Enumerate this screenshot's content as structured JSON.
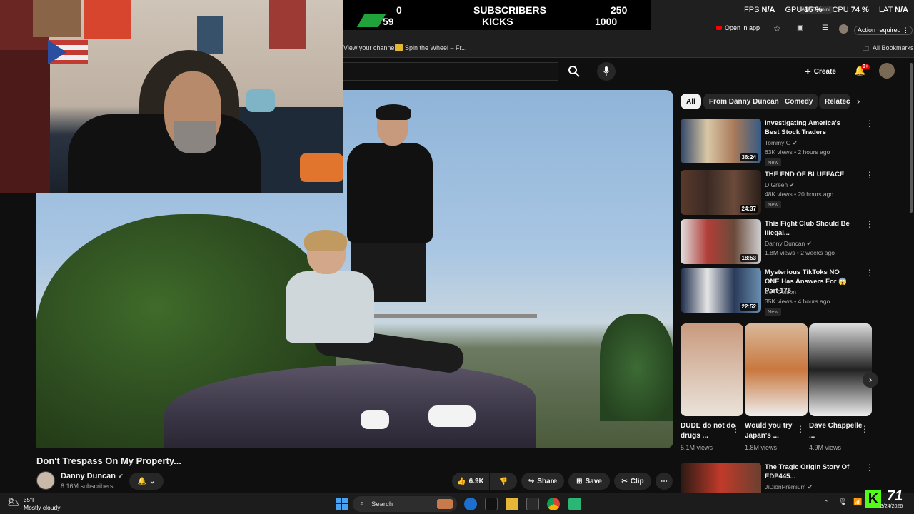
{
  "overlay": {
    "subscribers_left": "0",
    "subscribers_label": "SUBSCRIBERS",
    "subscribers_right": "250",
    "kicks_left": "59",
    "kicks_label": "KICKS",
    "kicks_right": "1000"
  },
  "stats": {
    "fps_label": "FPS",
    "fps_value": "N/A",
    "gpu_label": "GPU",
    "gpu_value": "15 %",
    "cpu_label": "CPU",
    "cpu_value": "74 %",
    "lat_label": "LAT",
    "lat_value": "N/A",
    "ask_gemini": "Ask Gemini"
  },
  "browser": {
    "open_in_app": "Open in app",
    "action_required": "Action required",
    "bookmark1": "View your channel",
    "bookmark2": "Spin the Wheel – Fr...",
    "all_bookmarks": "All Bookmarks"
  },
  "youtube": {
    "create_label": "Create",
    "notification_badge": "9+"
  },
  "video": {
    "title": "Don't Trespass On My Property...",
    "channel_name": "Danny Duncan",
    "subscribers": "8.16M subscribers",
    "likes": "6.9K",
    "share_label": "Share",
    "save_label": "Save",
    "clip_label": "Clip"
  },
  "chips": [
    "All",
    "From Danny Duncan",
    "Comedy",
    "Relatec"
  ],
  "recommendations": [
    {
      "title": "Investigating America's Best Stock Traders",
      "channel": "Tommy G",
      "meta": "63K views • 2 hours ago",
      "duration": "36:24",
      "new": "New"
    },
    {
      "title": "THE END OF BLUEFACE",
      "channel": "D Green",
      "meta": "48K views • 20 hours ago",
      "duration": "24:37",
      "new": "New"
    },
    {
      "title": "This Fight Club Should Be Illegal...",
      "channel": "Danny Duncan",
      "meta": "1.8M views • 2 weeks ago",
      "duration": "18:53",
      "new": ""
    },
    {
      "title": "Mysterious TikToks NO ONE Has Answers For 😱 Part 175",
      "channel": "Ben Colson",
      "meta": "35K views • 4 hours ago",
      "duration": "22:52",
      "new": "New"
    }
  ],
  "shorts": [
    {
      "title": "DUDE do not do drugs ...",
      "views": "5.1M views"
    },
    {
      "title": "Would you try Japan's ...",
      "views": "1.8M views"
    },
    {
      "title": "Dave Chappelle ...",
      "views": "4.9M views"
    }
  ],
  "last_rec": {
    "title": "The Tragic Origin Story Of EDP445...",
    "channel": "JiDionPremium"
  },
  "taskbar": {
    "temperature": "35°F",
    "weather": "Mostly cloudy",
    "search_label": "Search",
    "date": "3/24/2026",
    "kick_badge": "71"
  },
  "webcam": {
    "shirt_logo": "~ ~"
  }
}
